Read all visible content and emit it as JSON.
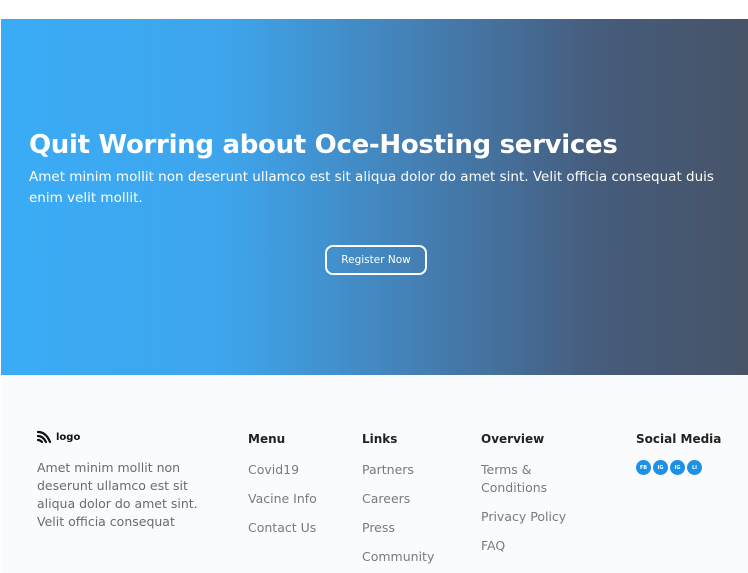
{
  "hero": {
    "title": "Quit Worring about Oce-Hosting services",
    "subtitle": "Amet minim mollit non deserunt ullamco est sit aliqua dolor do amet sint. Velit officia consequat duis enim velit mollit.",
    "cta_label": "Register Now",
    "gradient_colors": [
      "#3aacf6",
      "#475468"
    ]
  },
  "footer": {
    "logo_text": "logo",
    "description": "Amet minim mollit non deserunt ullamco est sit aliqua dolor do amet sint. Velit officia consequat",
    "menu": {
      "title": "Menu",
      "items": [
        "Covid19",
        "Vacine Info",
        "Contact Us"
      ]
    },
    "links": {
      "title": "Links",
      "items": [
        "Partners",
        "Careers",
        "Press",
        "Community"
      ]
    },
    "overview": {
      "title": "Overview",
      "items": [
        "Terms & Conditions",
        "Privacy Policy",
        "FAQ"
      ]
    },
    "social": {
      "title": "Social Media",
      "icons": [
        {
          "label": "FB",
          "icon": "facebook-icon"
        },
        {
          "label": "IG",
          "icon": "instagram-icon"
        },
        {
          "label": "IG",
          "icon": "instagram-icon"
        },
        {
          "label": "LI",
          "icon": "linkedin-icon"
        }
      ],
      "accent": "#1e90e6"
    }
  }
}
